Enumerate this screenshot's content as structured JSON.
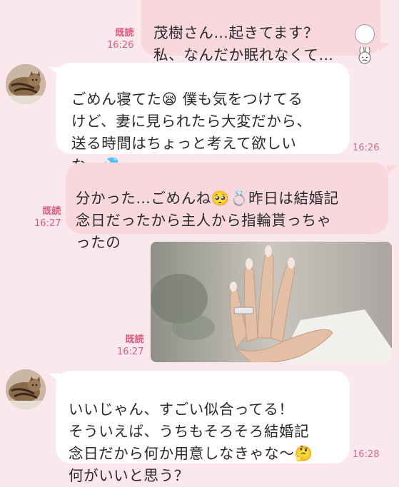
{
  "messages": [
    {
      "id": "m1",
      "side": "out",
      "text": "茂樹さん…起きてます？\n私、なんだか眠れなくて…",
      "read": "既読",
      "time": "16:26",
      "emoji": "bunny-crying-sticker"
    },
    {
      "id": "m2",
      "side": "in",
      "text": "ごめん寝てた😪 僕も気をつけてる\nけど、妻に見られたら大変だから、\n送る時間はちょっと考えて欲しい\nな…💦",
      "time": "16:26"
    },
    {
      "id": "m3",
      "side": "out",
      "text": "分かった…ごめんね🥺💍昨日は結婚記\n念日だったから主人から指輪貰っちゃ\nったの",
      "read": "既読",
      "time": "16:27"
    },
    {
      "id": "m4",
      "side": "out",
      "type": "image",
      "image_desc": "hand-with-ring-photo",
      "read": "既読",
      "time": "16:27"
    },
    {
      "id": "m5",
      "side": "in",
      "text": "いいじゃん、すごい似合ってる！\nそういえば、うちもそろそろ結婚記\n念日だから何か用意しなきゃな〜🤔\n何がいいと思う？",
      "time": "16:28"
    }
  ],
  "colors": {
    "background": "#fbe8ec",
    "outgoing_bubble": "#f8d7df",
    "incoming_bubble": "#ffffff",
    "read_label": "#e0577f"
  }
}
